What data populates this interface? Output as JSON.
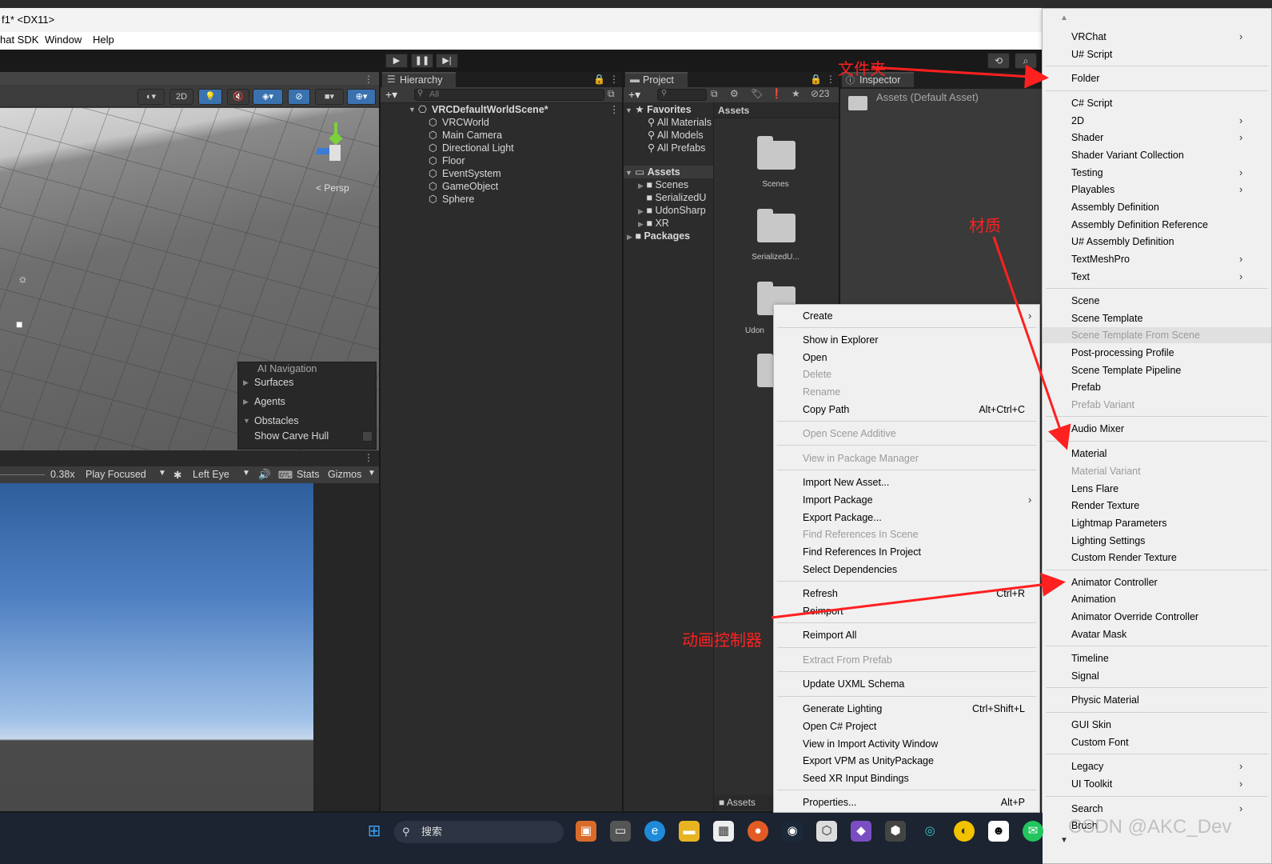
{
  "window": {
    "title": "f1* <DX11>"
  },
  "menubar": {
    "items": [
      "hat SDK",
      "Window",
      "Help"
    ]
  },
  "scene": {
    "mode_2d": "2D",
    "persp_label": "< Persp",
    "ai_navigation": {
      "title": "AI Navigation",
      "items": [
        "Surfaces",
        "Agents",
        "Obstacles",
        "Show Carve Hull"
      ]
    }
  },
  "game": {
    "scale": "0.38x",
    "play_mode": "Play Focused",
    "eye": "Left Eye",
    "stats": "Stats",
    "gizmos": "Gizmos"
  },
  "hierarchy": {
    "tab": "Hierarchy",
    "search_placeholder": "All",
    "scene": "VRCDefaultWorldScene*",
    "objects": [
      "VRCWorld",
      "Main Camera",
      "Directional Light",
      "Floor",
      "EventSystem",
      "GameObject",
      "Sphere"
    ]
  },
  "project": {
    "tab": "Project",
    "count": "23",
    "favorites": {
      "label": "Favorites",
      "items": [
        "All Materials",
        "All Models",
        "All Prefabs"
      ]
    },
    "assets": {
      "label": "Assets",
      "items": [
        "Scenes",
        "SerializedU",
        "UdonSharp",
        "XR"
      ]
    },
    "packages": "Packages",
    "grid_header": "Assets",
    "grid_items": [
      "Scenes",
      "SerializedU...",
      "Udon"
    ],
    "footer": "Assets"
  },
  "inspector": {
    "tab": "Inspector",
    "asset": "Assets (Default Asset)"
  },
  "context_menu": {
    "items": [
      {
        "label": "Create",
        "submenu": true
      },
      {
        "label": "Show in Explorer"
      },
      {
        "label": "Open"
      },
      {
        "label": "Delete",
        "disabled": true
      },
      {
        "label": "Rename",
        "disabled": true
      },
      {
        "label": "Copy Path",
        "shortcut": "Alt+Ctrl+C"
      },
      {
        "label": "Open Scene Additive",
        "disabled": true
      },
      {
        "label": "View in Package Manager",
        "disabled": true
      },
      {
        "label": "Import New Asset..."
      },
      {
        "label": "Import Package",
        "submenu": true
      },
      {
        "label": "Export Package..."
      },
      {
        "label": "Find References In Scene",
        "disabled": true
      },
      {
        "label": "Find References In Project"
      },
      {
        "label": "Select Dependencies"
      },
      {
        "label": "Refresh",
        "shortcut": "Ctrl+R"
      },
      {
        "label": "Reimport"
      },
      {
        "label": "Reimport All"
      },
      {
        "label": "Extract From Prefab",
        "disabled": true
      },
      {
        "label": "Update UXML Schema"
      },
      {
        "label": "Generate Lighting",
        "shortcut": "Ctrl+Shift+L"
      },
      {
        "label": "Open C# Project"
      },
      {
        "label": "View in Import Activity Window"
      },
      {
        "label": "Export VPM as UnityPackage"
      },
      {
        "label": "Seed XR Input Bindings"
      },
      {
        "label": "Properties...",
        "shortcut": "Alt+P"
      }
    ]
  },
  "create_menu": {
    "items": [
      {
        "label": "VRChat",
        "submenu": true
      },
      {
        "label": "U# Script"
      },
      {
        "label": "Folder"
      },
      {
        "label": "C# Script"
      },
      {
        "label": "2D",
        "submenu": true
      },
      {
        "label": "Shader",
        "submenu": true
      },
      {
        "label": "Shader Variant Collection"
      },
      {
        "label": "Testing",
        "submenu": true
      },
      {
        "label": "Playables",
        "submenu": true
      },
      {
        "label": "Assembly Definition"
      },
      {
        "label": "Assembly Definition Reference"
      },
      {
        "label": "U# Assembly Definition"
      },
      {
        "label": "TextMeshPro",
        "submenu": true
      },
      {
        "label": "Text",
        "submenu": true
      },
      {
        "label": "Scene"
      },
      {
        "label": "Scene Template"
      },
      {
        "label": "Scene Template From Scene",
        "disabled": true
      },
      {
        "label": "Post-processing Profile"
      },
      {
        "label": "Scene Template Pipeline"
      },
      {
        "label": "Prefab"
      },
      {
        "label": "Prefab Variant",
        "disabled": true
      },
      {
        "label": "Audio Mixer"
      },
      {
        "label": "Material"
      },
      {
        "label": "Material Variant",
        "disabled": true
      },
      {
        "label": "Lens Flare"
      },
      {
        "label": "Render Texture"
      },
      {
        "label": "Lightmap Parameters"
      },
      {
        "label": "Lighting Settings"
      },
      {
        "label": "Custom Render Texture"
      },
      {
        "label": "Animator Controller"
      },
      {
        "label": "Animation"
      },
      {
        "label": "Animator Override Controller"
      },
      {
        "label": "Avatar Mask"
      },
      {
        "label": "Timeline"
      },
      {
        "label": "Signal"
      },
      {
        "label": "Physic Material"
      },
      {
        "label": "GUI Skin"
      },
      {
        "label": "Custom Font"
      },
      {
        "label": "Legacy",
        "submenu": true
      },
      {
        "label": "UI Toolkit",
        "submenu": true
      },
      {
        "label": "Search",
        "submenu": true
      },
      {
        "label": "Brush"
      }
    ]
  },
  "annotations": {
    "folder": "文件夹",
    "material": "材质",
    "animator": "动画控制器",
    "watermark": "CSDN @AKC_Dev"
  },
  "taskbar": {
    "search_placeholder": "搜索"
  },
  "colors": {
    "annotation": "#ff2020",
    "accent": "#3a72b0"
  }
}
